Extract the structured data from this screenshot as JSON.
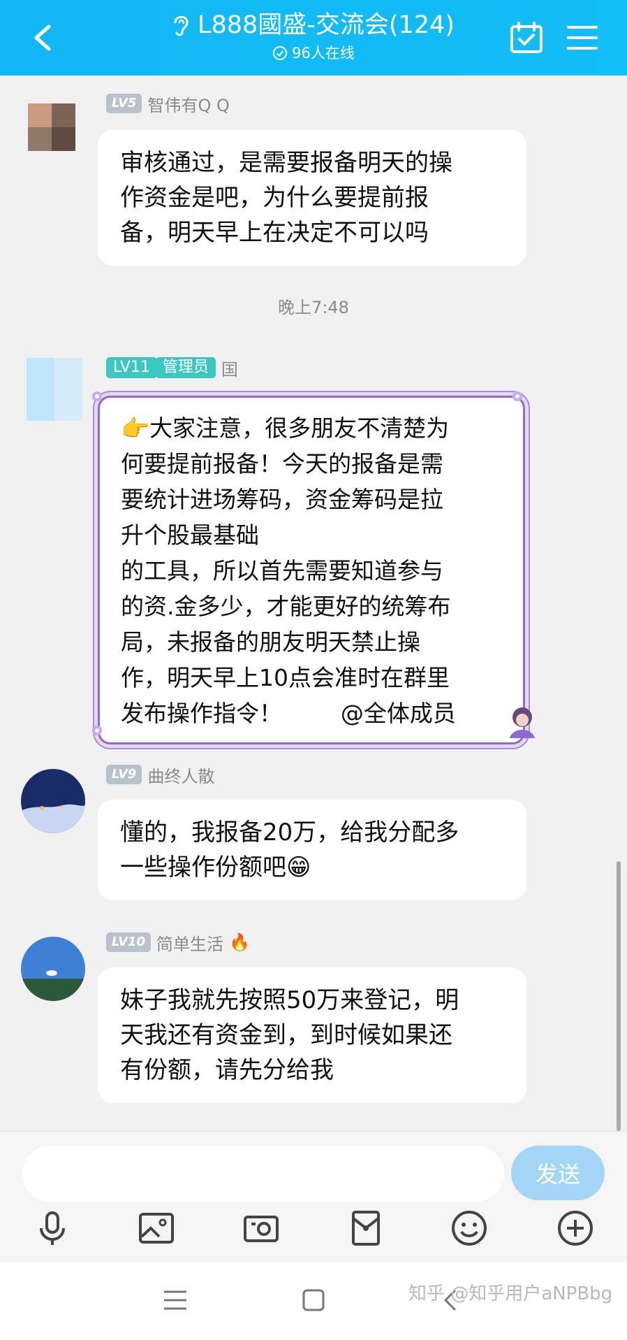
{
  "header": {
    "title": "L888國盛-交流会(124)",
    "online": "96人在线",
    "bg_color": "#13bdf6"
  },
  "messages": [
    {
      "level": "LV5",
      "name": "智伟有Q Q",
      "text": "审核通过，是需要报备明天的操\n作资金是吧，为什么要提前报\n备，明天早上在决定不可以吗"
    },
    {
      "level": "LV11",
      "role": "管理员",
      "name": "国",
      "text": "👉大家注意，很多朋友不清楚为\n何要提前报备！今天的报备是需\n要统计进场筹码，资金筹码是拉\n升个股最基础\n的工具，所以首先需要知道参与\n的资.金多少，才能更好的统筹布\n局，未报备的朋友明天禁止操\n作，明天早上10点会准时在群里\n发布操作指令！        @全体成员"
    },
    {
      "level": "LV9",
      "name": "曲终人散",
      "text": "懂的，我报备20万，给我分配多\n一些操作份额吧😁"
    },
    {
      "level": "LV10",
      "name": "简单生活",
      "badge": "🔥",
      "text": "妹子我就先按照50万来登记，明\n天我还有资金到，到时候如果还\n有份额，请先分给我"
    }
  ],
  "timestamp": "晚上7:48",
  "input": {
    "placeholder": "",
    "send_label": "发送"
  },
  "toolbar": [
    "mic-icon",
    "image-icon",
    "camera-icon",
    "red-packet-icon",
    "emoji-icon",
    "plus-icon"
  ],
  "navbar": [
    "menu-icon",
    "home-icon",
    "back-icon"
  ],
  "watermark": "知乎 @知乎用户aNPBbg"
}
